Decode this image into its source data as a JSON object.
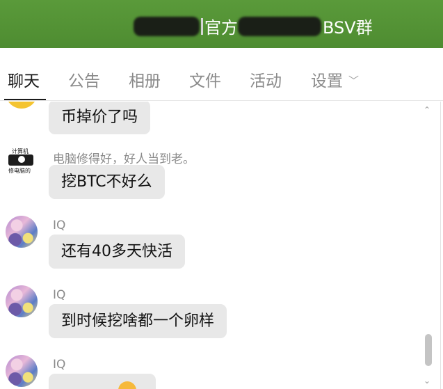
{
  "header": {
    "title_middle": "官方",
    "title_suffix": "BSV群",
    "bg_color": "#4e8c31"
  },
  "tabs": [
    {
      "label": "聊天",
      "active": true
    },
    {
      "label": "公告",
      "active": false
    },
    {
      "label": "相册",
      "active": false
    },
    {
      "label": "文件",
      "active": false
    },
    {
      "label": "活动",
      "active": false
    },
    {
      "label": "设置",
      "active": false,
      "has_dropdown": true
    }
  ],
  "scroll": {
    "up_icon": "⌃",
    "down_icon": "⌄"
  },
  "messages": [
    {
      "sender": "",
      "text": "币掉价了吗",
      "avatar": "yellow-avatar"
    },
    {
      "sender": "电脑修得好，好人当到老。",
      "text": "挖BTC不好么",
      "avatar": "ink-avatar",
      "avatar_text_top": "计算机",
      "avatar_text_bottom": "修电脑的"
    },
    {
      "sender": "IQ",
      "text": "还有40多天快活",
      "avatar": "anime-avatar"
    },
    {
      "sender": "IQ",
      "text": "到时候挖啥都一个卵样",
      "avatar": "anime-avatar"
    },
    {
      "sender": "IQ",
      "text": "",
      "avatar": "anime-avatar"
    }
  ]
}
